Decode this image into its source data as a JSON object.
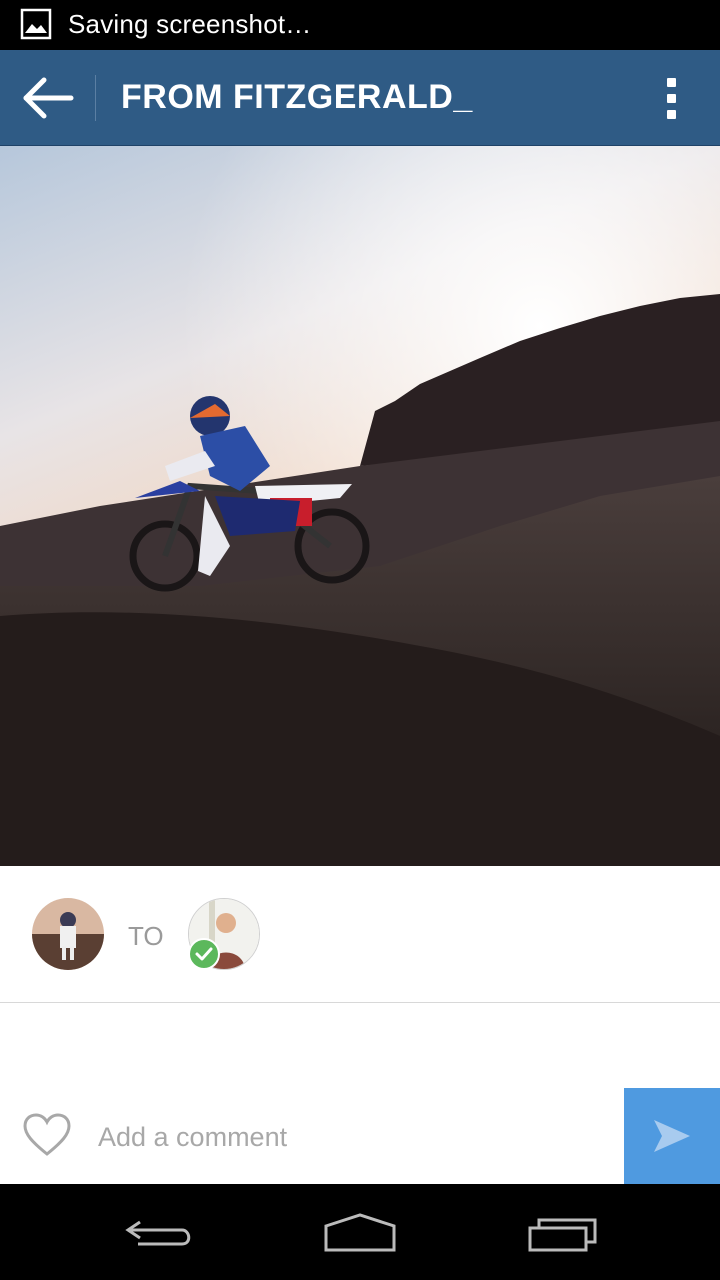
{
  "status_bar": {
    "notification_icon": "image-icon",
    "text": "Saving screenshot…"
  },
  "app_bar": {
    "back_icon": "arrow-left-icon",
    "title": "FROM FITZGERALD_",
    "overflow_icon": "more-vert-icon",
    "color": "#2f5b85"
  },
  "photo": {
    "description_icon": "motocross-photo"
  },
  "recipients": {
    "to_label": "TO",
    "badge_icon": "check-circle-icon",
    "badge_color": "#5cb85c"
  },
  "comment": {
    "like_icon": "heart-outline-icon",
    "placeholder": "Add a comment",
    "value": "",
    "send_icon": "send-icon",
    "send_color": "#4f9ae0"
  },
  "nav_bar": {
    "back_icon": "nav-back-icon",
    "home_icon": "nav-home-icon",
    "recents_icon": "nav-recents-icon"
  }
}
